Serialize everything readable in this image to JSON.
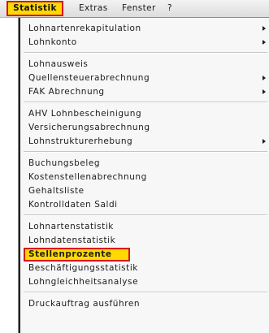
{
  "menubar": {
    "items": [
      {
        "label": "Statistik"
      },
      {
        "label": "Extras"
      },
      {
        "label": "Fenster"
      },
      {
        "label": "?"
      }
    ]
  },
  "menu": {
    "groups": [
      {
        "items": [
          {
            "label": "Lohnartenrekapitulation",
            "submenu": true
          },
          {
            "label": "Lohnkonto",
            "submenu": true
          }
        ]
      },
      {
        "items": [
          {
            "label": "Lohnausweis",
            "submenu": false
          },
          {
            "label": "Quellensteuerabrechnung",
            "submenu": true
          },
          {
            "label": "FAK Abrechnung",
            "submenu": true
          }
        ]
      },
      {
        "items": [
          {
            "label": "AHV Lohnbescheinigung",
            "submenu": false
          },
          {
            "label": "Versicherungsabrechnung",
            "submenu": false
          },
          {
            "label": "Lohnstrukturerhebung",
            "submenu": true
          }
        ]
      },
      {
        "items": [
          {
            "label": "Buchungsbeleg",
            "submenu": false
          },
          {
            "label": "Kostenstellenabrechnung",
            "submenu": false
          },
          {
            "label": "Gehaltsliste",
            "submenu": false
          },
          {
            "label": "Kontrolldaten Saldi",
            "submenu": false
          }
        ]
      },
      {
        "items": [
          {
            "label": "Lohnartenstatistik",
            "submenu": false
          },
          {
            "label": "Lohndatenstatistik",
            "submenu": false
          },
          {
            "label": "Stellenprozente",
            "submenu": false,
            "highlighted": true
          },
          {
            "label": "Beschäftigungsstatistik",
            "submenu": false
          },
          {
            "label": "Lohngleichheitsanalyse",
            "submenu": false
          }
        ]
      },
      {
        "items": [
          {
            "label": "Druckauftrag ausführen",
            "submenu": false
          }
        ]
      }
    ]
  },
  "colors": {
    "highlight_fill": "#ffd900",
    "highlight_border": "#d9141a"
  }
}
